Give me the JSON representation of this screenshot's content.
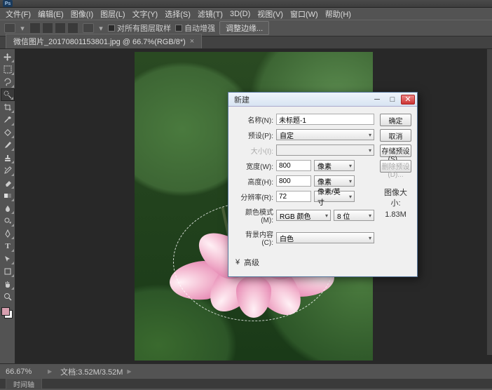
{
  "app": {
    "logo_text": "Ps"
  },
  "menu": {
    "file": "文件(F)",
    "edit": "编辑(E)",
    "image": "图像(I)",
    "layer": "图层(L)",
    "type": "文字(Y)",
    "select": "选择(S)",
    "filter": "滤镜(T)",
    "threeD": "3D(D)",
    "view": "视图(V)",
    "window": "窗口(W)",
    "help": "帮助(H)"
  },
  "options": {
    "sample_all": "对所有图层取样",
    "auto_enhance": "自动增强",
    "refine_edge": "调整边缘..."
  },
  "doctab": {
    "title": "微信图片_20170801153801.jpg @ 66.7%(RGB/8*)",
    "close": "×"
  },
  "status": {
    "zoom": "66.67%",
    "docinfo": "文档:3.52M/3.52M",
    "timeline": "时间轴"
  },
  "dialog": {
    "title": "新建",
    "name_label": "名称(N):",
    "name_value": "未标题-1",
    "preset_label": "预设(P):",
    "preset_value": "自定",
    "size_label": "大小(I):",
    "size_value": "",
    "width_label": "宽度(W):",
    "width_value": "800",
    "width_unit": "像素",
    "height_label": "高度(H):",
    "height_value": "800",
    "height_unit": "像素",
    "res_label": "分辨率(R):",
    "res_value": "72",
    "res_unit": "像素/英寸",
    "mode_label": "颜色模式(M):",
    "mode_value": "RGB 颜色",
    "mode_bits": "8 位",
    "bg_label": "背景内容(C):",
    "bg_value": "白色",
    "advanced": "高级",
    "advanced_chevron": "¥",
    "ok": "确定",
    "cancel": "取消",
    "save_preset": "存储预设(S)...",
    "delete_preset": "删除预设(D)...",
    "imgsize_label": "图像大小:",
    "imgsize_value": "1.83M"
  }
}
